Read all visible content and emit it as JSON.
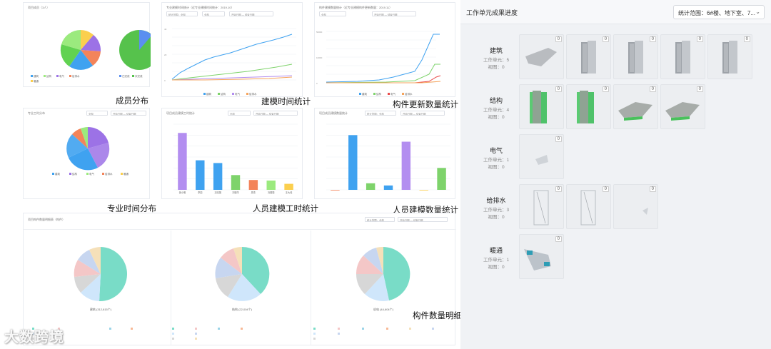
{
  "captions": {
    "member_dist": "成员分布",
    "modeling_time": "建模时间统计",
    "component_updates": "构件更新数量统计",
    "discipline_time": "专业时间分布",
    "person_hours": "人员建模工时统计",
    "person_count": "人员建模数量统计",
    "component_detail": "构件数量明细"
  },
  "charts": {
    "modeling_time_title": "专业建模时间统计（近专业建模时间统计：2019.10）",
    "update_title": "构件建模数量统计（近专业建模构件更新数量：2019.11）",
    "discipline_title": "专业工时分布",
    "hours_title": "项目成员建模工时统计",
    "count_title": "项目成员建模数量统计",
    "detail_title": "项目构件数量明细表（构件）",
    "member_title": "项目成员（3人）",
    "filter_all": "全部",
    "filter_range": "统计范围：全部",
    "filter_date": "开始日期  —  结束日期",
    "detail_labels": [
      "建筑 (312,815个)",
      "结构 (22,004个)",
      "机电 (44,604个)"
    ]
  },
  "right": {
    "title": "工作单元成果进度",
    "range_select": "统计范围：6#楼、地下室、7...",
    "chevron_icon": "chevron-down-icon",
    "categories": [
      {
        "name": "建筑",
        "units": "工作单元：5",
        "views": "视图：0",
        "thumbs": [
          "0",
          "0",
          "0",
          "0",
          "0"
        ]
      },
      {
        "name": "结构",
        "units": "工作单元：4",
        "views": "视图：0",
        "thumbs": [
          "0",
          "0",
          "0",
          "0"
        ]
      },
      {
        "name": "电气",
        "units": "工作单元：1",
        "views": "视图：0",
        "thumbs": [
          "0"
        ]
      },
      {
        "name": "给排水",
        "units": "工作单元：3",
        "views": "视图：0",
        "thumbs": [
          "0",
          "0",
          "0"
        ]
      },
      {
        "name": "暖通",
        "units": "工作单元：1",
        "views": "视图：0",
        "thumbs": [
          "0"
        ]
      }
    ]
  },
  "watermark": "大数跨境",
  "chart_data": [
    {
      "type": "bar",
      "title": "项目成员建模工时统计",
      "categories": [
        "张小明",
        "李四",
        "王晓丽",
        "刘德华",
        "周杰",
        "冯丽丽",
        "王大伟"
      ],
      "values": [
        5200,
        2700,
        2450,
        1350,
        900,
        850,
        550
      ],
      "ylim": [
        0,
        6000
      ]
    },
    {
      "type": "bar",
      "title": "项目成员建模数量统计",
      "categories": [
        "A",
        "B",
        "C",
        "D",
        "E",
        "F",
        "G"
      ],
      "values": [
        0,
        500,
        60,
        40,
        440,
        0,
        200
      ],
      "ylim": [
        0,
        600
      ]
    }
  ]
}
